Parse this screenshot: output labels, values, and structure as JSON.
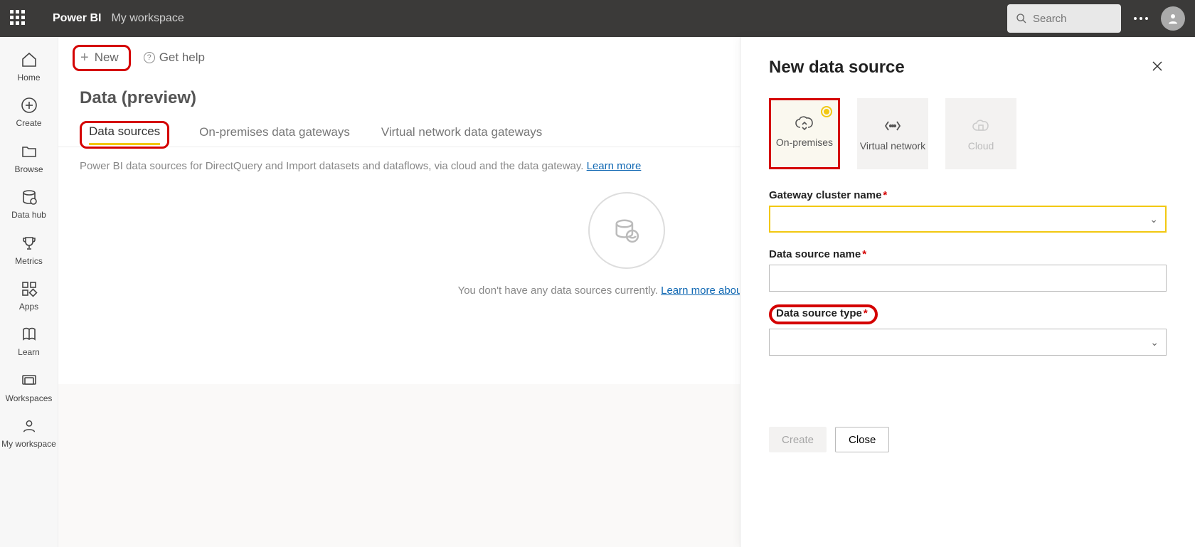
{
  "header": {
    "app": "Power BI",
    "workspace": "My workspace",
    "search_placeholder": "Search"
  },
  "nav": {
    "items": [
      {
        "label": "Home"
      },
      {
        "label": "Create"
      },
      {
        "label": "Browse"
      },
      {
        "label": "Data hub"
      },
      {
        "label": "Metrics"
      },
      {
        "label": "Apps"
      },
      {
        "label": "Learn"
      },
      {
        "label": "Workspaces"
      },
      {
        "label": "My workspace"
      }
    ]
  },
  "toolbar": {
    "new_label": "New",
    "help_label": "Get help"
  },
  "page": {
    "title": "Data (preview)",
    "tabs": [
      {
        "label": "Data sources"
      },
      {
        "label": "On-premises data gateways"
      },
      {
        "label": "Virtual network data gateways"
      }
    ],
    "description_text": "Power BI data sources for DirectQuery and Import datasets and dataflows, via cloud and the data gateway. ",
    "description_link": "Learn more",
    "empty_text": "You don't have any data sources currently. ",
    "empty_link": "Learn more about supported"
  },
  "panel": {
    "title": "New data source",
    "options": [
      {
        "label": "On-premises"
      },
      {
        "label": "Virtual network"
      },
      {
        "label": "Cloud"
      }
    ],
    "fields": {
      "gateway_cluster": "Gateway cluster name",
      "data_source_name": "Data source name",
      "data_source_type": "Data source type"
    },
    "actions": {
      "create": "Create",
      "close": "Close"
    }
  }
}
